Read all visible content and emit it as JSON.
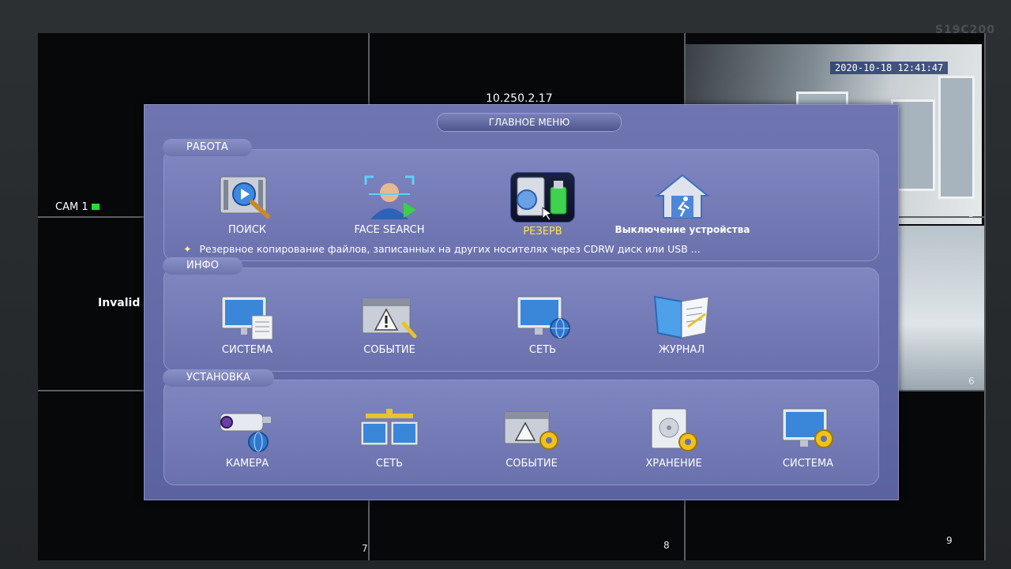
{
  "monitor": {
    "model": "S19C200"
  },
  "background": {
    "ip_address": "10.250.2.17",
    "camera_label": "CAM 1",
    "invalid_text": "Invalid",
    "timestamp": "2020-10-18 12:41:47",
    "cell_numbers": {
      "c3": "3",
      "c6": "6",
      "c7": "7",
      "c8": "8",
      "c9": "9"
    }
  },
  "menu": {
    "title": "ГЛАВНОЕ МЕНЮ",
    "sections": [
      {
        "title": "РАБОТА",
        "items": [
          {
            "label": "ПОИСК",
            "icon": "film-search-icon"
          },
          {
            "label": "FACE SEARCH",
            "icon": "face-search-icon"
          },
          {
            "label": "РЕЗЕРВ",
            "icon": "backup-usb-icon",
            "selected": true
          },
          {
            "label": "Выключение устройства",
            "icon": "shutdown-house-icon"
          }
        ],
        "hint": "Резервное копирование файлов, записанных на других носителях через CDRW диск или USB ..."
      },
      {
        "title": "ИНФО",
        "items": [
          {
            "label": "СИСТЕМА",
            "icon": "system-info-icon"
          },
          {
            "label": "СОБЫТИЕ",
            "icon": "event-warning-icon"
          },
          {
            "label": "СЕТЬ",
            "icon": "network-globe-icon"
          },
          {
            "label": "ЖУРНАЛ",
            "icon": "journal-book-icon"
          }
        ]
      },
      {
        "title": "УСТАНОВКА",
        "items": [
          {
            "label": "КАМЕРА",
            "icon": "camera-setup-icon"
          },
          {
            "label": "СЕТЬ",
            "icon": "network-setup-icon"
          },
          {
            "label": "СОБЫТИЕ",
            "icon": "event-setup-icon"
          },
          {
            "label": "ХРАНЕНИЕ",
            "icon": "storage-setup-icon"
          },
          {
            "label": "СИСТЕМА",
            "icon": "system-setup-icon"
          }
        ]
      }
    ]
  },
  "colors": {
    "selected_label": "#ffe64a",
    "menu_bg": "#6e75b0"
  }
}
